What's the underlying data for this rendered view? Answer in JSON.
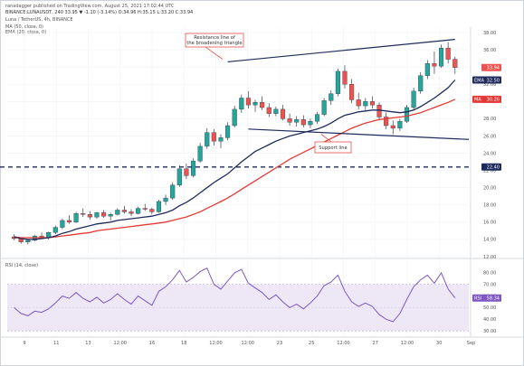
{
  "header": {
    "published": "ranadagger published on TradingView.com, August 25, 2021 17:02:44 UTC",
    "symbol_line": "BINANCE:LUNAUSDT, 240  33.95  ▼ -1.10 (-3.14%)  O:34.96  H:35.15  L:33.20  C:33.94",
    "title": "Luna / TetherUS, 4h, BINANCE",
    "ma_label": "MA (50, close, 0)",
    "ema_label": "EMA (20, close, 0)"
  },
  "rsi_label": "RSI (14, close)",
  "colors": {
    "up": "#26a69a",
    "down": "#ef5350",
    "candle_body": "#2f3e4e",
    "ema": "#1f2b5c",
    "ma": "#e53935",
    "trendline": "#1f2b5c",
    "support_dash": "#1f2b5c",
    "rsi_line": "#7e57c2",
    "rsi_band": "#ede7f6",
    "annotation_border": "#e53935"
  },
  "chart_data": [
    {
      "type": "candlestick",
      "title": "Luna / TetherUS, 4h, BINANCE",
      "x": [
        "9",
        "11",
        "13",
        "12:00",
        "16",
        "18",
        "12:00",
        "12:00",
        "23",
        "25",
        "12:00",
        "27",
        "12:00",
        "30",
        "Sep"
      ],
      "ylim": [
        12.0,
        38.0
      ],
      "y_ticks": [
        12.0,
        14.0,
        16.0,
        18.0,
        20.0,
        22.0,
        24.0,
        26.0,
        28.0,
        30.0,
        32.0,
        34.0,
        36.0,
        38.0
      ],
      "price_badges": [
        {
          "label": "",
          "value": "33.94"
        },
        {
          "label": "EMA",
          "value": "32.50"
        },
        {
          "label": "MA",
          "value": "30.26"
        },
        {
          "label": "",
          "value": "22.40"
        }
      ],
      "horizontal_support_level": 22.4,
      "annotations": [
        "Resistance line of the broadening triangle",
        "Support line"
      ],
      "candles": [
        [
          14.3,
          14.6,
          13.9,
          14.1
        ],
        [
          14.1,
          14.2,
          13.5,
          13.7
        ],
        [
          13.7,
          14.0,
          13.4,
          13.9
        ],
        [
          13.9,
          14.5,
          13.8,
          14.4
        ],
        [
          14.4,
          14.8,
          14.1,
          14.2
        ],
        [
          14.2,
          14.9,
          14.0,
          14.8
        ],
        [
          14.8,
          15.6,
          14.6,
          15.4
        ],
        [
          15.4,
          16.4,
          15.2,
          16.2
        ],
        [
          16.2,
          16.8,
          15.8,
          16.0
        ],
        [
          16.0,
          17.2,
          15.9,
          17.0
        ],
        [
          17.0,
          17.6,
          16.6,
          16.9
        ],
        [
          16.9,
          17.3,
          16.3,
          16.6
        ],
        [
          16.6,
          17.2,
          16.4,
          17.1
        ],
        [
          17.1,
          17.4,
          16.5,
          16.7
        ],
        [
          16.7,
          17.1,
          16.2,
          16.9
        ],
        [
          16.9,
          17.6,
          16.8,
          17.4
        ],
        [
          17.4,
          17.9,
          17.0,
          17.2
        ],
        [
          17.2,
          17.5,
          16.7,
          17.0
        ],
        [
          17.0,
          17.8,
          16.9,
          17.6
        ],
        [
          17.6,
          18.1,
          17.3,
          17.5
        ],
        [
          17.5,
          17.7,
          16.9,
          17.2
        ],
        [
          17.2,
          18.6,
          17.1,
          18.4
        ],
        [
          18.4,
          19.2,
          18.0,
          18.8
        ],
        [
          18.8,
          20.6,
          18.6,
          20.3
        ],
        [
          20.3,
          22.6,
          20.1,
          22.2
        ],
        [
          22.2,
          22.8,
          21.0,
          21.4
        ],
        [
          21.4,
          23.4,
          21.2,
          23.1
        ],
        [
          23.1,
          25.2,
          22.9,
          24.8
        ],
        [
          24.8,
          26.9,
          24.5,
          26.4
        ],
        [
          26.4,
          26.8,
          24.9,
          25.4
        ],
        [
          25.4,
          26.2,
          24.6,
          25.8
        ],
        [
          25.8,
          27.6,
          25.5,
          27.2
        ],
        [
          27.2,
          29.5,
          27.0,
          29.1
        ],
        [
          29.1,
          30.8,
          28.7,
          30.4
        ],
        [
          30.4,
          31.2,
          29.2,
          29.6
        ],
        [
          29.6,
          30.2,
          28.8,
          29.9
        ],
        [
          29.9,
          30.6,
          29.0,
          29.3
        ],
        [
          29.3,
          29.8,
          28.2,
          28.6
        ],
        [
          28.6,
          29.4,
          28.3,
          29.1
        ],
        [
          29.1,
          29.6,
          27.8,
          28.0
        ],
        [
          28.0,
          28.6,
          27.2,
          27.6
        ],
        [
          27.6,
          28.3,
          27.1,
          27.9
        ],
        [
          27.9,
          28.4,
          27.0,
          27.3
        ],
        [
          27.3,
          28.0,
          26.9,
          27.7
        ],
        [
          27.7,
          28.8,
          27.4,
          28.5
        ],
        [
          28.5,
          30.4,
          28.3,
          30.1
        ],
        [
          30.1,
          31.3,
          29.6,
          30.9
        ],
        [
          30.9,
          33.8,
          30.6,
          33.5
        ],
        [
          33.5,
          34.2,
          31.5,
          32.0
        ],
        [
          32.0,
          32.6,
          29.8,
          30.2
        ],
        [
          30.2,
          31.0,
          29.1,
          29.5
        ],
        [
          29.5,
          30.4,
          29.0,
          30.0
        ],
        [
          30.0,
          30.6,
          29.2,
          29.6
        ],
        [
          29.6,
          29.9,
          27.8,
          28.2
        ],
        [
          28.2,
          28.7,
          26.8,
          27.2
        ],
        [
          27.2,
          27.8,
          26.2,
          26.9
        ],
        [
          26.9,
          28.0,
          26.6,
          27.7
        ],
        [
          27.7,
          29.6,
          27.5,
          29.3
        ],
        [
          29.3,
          31.6,
          29.0,
          31.2
        ],
        [
          31.2,
          33.4,
          30.9,
          33.0
        ],
        [
          33.0,
          34.8,
          32.6,
          34.4
        ],
        [
          34.4,
          35.8,
          33.2,
          34.1
        ],
        [
          34.1,
          36.6,
          33.9,
          36.2
        ],
        [
          36.2,
          36.9,
          34.4,
          34.9
        ],
        [
          34.9,
          35.2,
          33.2,
          33.94
        ]
      ],
      "ema_20": [
        14.3,
        14.1,
        14.0,
        14.0,
        14.1,
        14.2,
        14.4,
        14.7,
        14.9,
        15.2,
        15.4,
        15.6,
        15.8,
        15.9,
        16.0,
        16.2,
        16.3,
        16.4,
        16.5,
        16.6,
        16.7,
        16.9,
        17.1,
        17.4,
        17.9,
        18.3,
        18.8,
        19.4,
        20.0,
        20.6,
        21.1,
        21.6,
        22.3,
        23.0,
        23.6,
        24.2,
        24.6,
        25.0,
        25.4,
        25.7,
        26.0,
        26.2,
        26.4,
        26.6,
        26.8,
        27.1,
        27.5,
        28.0,
        28.4,
        28.6,
        28.8,
        28.9,
        29.0,
        29.0,
        28.9,
        28.8,
        28.7,
        28.8,
        29.0,
        29.4,
        29.9,
        30.4,
        31.0,
        31.6,
        32.5
      ],
      "ma_50": [
        14.3,
        14.2,
        14.2,
        14.2,
        14.2,
        14.2,
        14.3,
        14.4,
        14.5,
        14.6,
        14.7,
        14.8,
        15.0,
        15.1,
        15.2,
        15.3,
        15.4,
        15.5,
        15.6,
        15.7,
        15.8,
        15.9,
        16.0,
        16.2,
        16.4,
        16.6,
        16.9,
        17.2,
        17.6,
        18.0,
        18.4,
        18.8,
        19.3,
        19.8,
        20.3,
        20.8,
        21.3,
        21.8,
        22.3,
        22.8,
        23.3,
        23.7,
        24.1,
        24.5,
        24.9,
        25.3,
        25.7,
        26.1,
        26.5,
        26.9,
        27.2,
        27.5,
        27.7,
        27.9,
        28.0,
        28.1,
        28.2,
        28.3,
        28.5,
        28.7,
        29.0,
        29.3,
        29.6,
        29.9,
        30.26
      ],
      "resistance_line": [
        [
          31,
          34.6
        ],
        [
          64,
          37.2
        ]
      ],
      "support_line": [
        [
          34,
          26.8
        ],
        [
          66,
          25.6
        ]
      ]
    },
    {
      "type": "line",
      "title": "RSI (14, close)",
      "ylim": [
        27.0,
        90.0
      ],
      "y_ticks": [
        30.0,
        40.0,
        50.0,
        60.0,
        70.0,
        80.0
      ],
      "band": [
        30.0,
        70.0
      ],
      "last_value": "58.34",
      "values": [
        50,
        45,
        43,
        47,
        46,
        49,
        54,
        60,
        58,
        63,
        58,
        55,
        59,
        54,
        57,
        62,
        57,
        53,
        60,
        56,
        52,
        64,
        68,
        74,
        82,
        72,
        76,
        81,
        84,
        70,
        66,
        73,
        80,
        83,
        71,
        67,
        63,
        57,
        61,
        55,
        50,
        53,
        49,
        54,
        60,
        69,
        72,
        78,
        64,
        55,
        51,
        54,
        51,
        44,
        40,
        38,
        45,
        57,
        68,
        74,
        78,
        71,
        80,
        66,
        58.34
      ]
    }
  ]
}
